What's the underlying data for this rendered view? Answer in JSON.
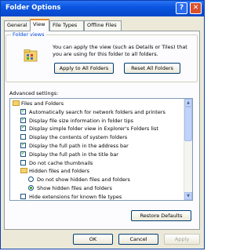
{
  "window": {
    "title": "Folder Options"
  },
  "titlebar": {
    "help_label": "?",
    "close_label": "✕"
  },
  "tabs": [
    {
      "label": "General",
      "active": false
    },
    {
      "label": "View",
      "active": true
    },
    {
      "label": "File Types",
      "active": false
    },
    {
      "label": "Offline Files",
      "active": false
    }
  ],
  "folder_views": {
    "group_label": "Folder views",
    "description": "You can apply the view (such as Details or Tiles) that you are using for this folder to all folders.",
    "apply_label": "Apply to All Folders",
    "reset_label": "Reset All Folders"
  },
  "advanced": {
    "label": "Advanced settings:",
    "items": [
      {
        "type": "folder",
        "indent": 0,
        "text": "Files and Folders"
      },
      {
        "type": "checkbox",
        "indent": 1,
        "checked": true,
        "text": "Automatically search for network folders and printers"
      },
      {
        "type": "checkbox",
        "indent": 1,
        "checked": true,
        "text": "Display file size information in folder tips"
      },
      {
        "type": "checkbox",
        "indent": 1,
        "checked": true,
        "text": "Display simple folder view in Explorer's Folders list"
      },
      {
        "type": "checkbox",
        "indent": 1,
        "checked": false,
        "text": "Display the contents of system folders"
      },
      {
        "type": "checkbox",
        "indent": 1,
        "checked": true,
        "text": "Display the full path in the address bar"
      },
      {
        "type": "checkbox",
        "indent": 1,
        "checked": true,
        "text": "Display the full path in the title bar"
      },
      {
        "type": "checkbox",
        "indent": 1,
        "checked": false,
        "text": "Do not cache thumbnails"
      },
      {
        "type": "folder",
        "indent": 1,
        "text": "Hidden files and folders"
      },
      {
        "type": "radio",
        "indent": 2,
        "checked": false,
        "text": "Do not show hidden files and folders"
      },
      {
        "type": "radio",
        "indent": 2,
        "checked": true,
        "text": "Show hidden files and folders"
      },
      {
        "type": "checkbox",
        "indent": 1,
        "checked": false,
        "text": "Hide extensions for known file types"
      }
    ]
  },
  "buttons": {
    "restore_label": "Restore Defaults",
    "ok_label": "OK",
    "cancel_label": "Cancel",
    "apply_label": "Apply",
    "apply_enabled": false
  },
  "colors": {
    "titlebar": "#0a55e0",
    "active_tab_accent": "#e68b2c",
    "group_label": "#0046d5",
    "check_mark": "#21a121"
  }
}
